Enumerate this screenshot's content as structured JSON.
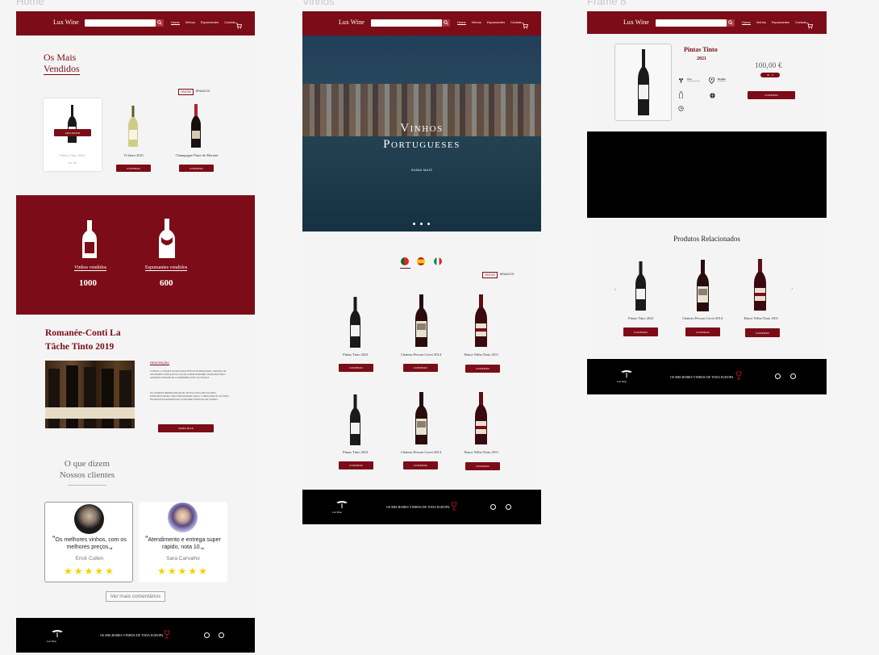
{
  "frames": {
    "home": "Home",
    "vinhos": "Vinhos",
    "frame8": "Frame 8"
  },
  "nav": {
    "logo": "Lux Wine",
    "links": [
      "Home",
      "Vinhos",
      "Espumantes",
      "Contato"
    ],
    "active_link_home": "Home",
    "active_link_vinhos": "Home"
  },
  "home": {
    "best_title_1": "Os Mais",
    "best_title_2": "Vendidos",
    "toggle": [
      "TINTOS",
      "BRANCOS"
    ],
    "products": [
      {
        "name": "Pintas Tinto 2021",
        "price": "R$ 289",
        "overlay": "ADICIONAR",
        "button": ""
      },
      {
        "name": "O Sarro 2021",
        "price": "",
        "button": "COMPRAR"
      },
      {
        "name": "Champagne Pinot de Moroné",
        "price": "",
        "button": "COMPRAR"
      }
    ],
    "stats": [
      {
        "label": "Vinhos vendidos",
        "value": "1000"
      },
      {
        "label": "Espumantes vendidos",
        "value": "600"
      }
    ],
    "feature_title_1": "Romanée-Conti La",
    "feature_title_2": "Tâche Tinto 2019",
    "desc_heading": "DESCRIÇÃO",
    "desc_p1": "O VINHO LA TÂCHE É UM DOS MAIS MÍTICOS DA BORGONHA, ORIUNDO DE UM VINHEDO SINGULAR NA VILA DE VOSNE-ROMANÉE, PRODUZIDO PELO LENDÁRIO DOMAINE DE LA ROMANÉE-CONTI, NA FRANÇA.",
    "desc_p2": "OS VINHEDOS BENEFICIAM-SE DE UM SOLO RICO EM CALCÁRIO, PROPORCIONANDO UMA COMPLEXIDADE ÚNICA. O RESULTADO É UM VINHO DE ELEGÂNCIA EXCEPCIONAL E GRANDE POTENCIAL DE GUARDA.",
    "more_button": "SAIBA MAIS",
    "reviews_title_1": "O que dizem",
    "reviews_title_2": "Nossos clientes",
    "reviews": [
      {
        "quote": "Os melhores vinhos, com os melhores  preços.",
        "name": "Erick Cullen",
        "stars": "★★★★★"
      },
      {
        "quote": "Atendimento e entrega super rapido, nota 10.",
        "name": "Sara Carvalho",
        "stars": "★★★★★"
      }
    ],
    "more_comments": "Ver mais comentários"
  },
  "vinhos": {
    "hero_line1": "Vinhos",
    "hero_line2": "Portugueses",
    "hero_button": "SAIBA MAIS",
    "toggle": [
      "TINTOS",
      "BRANCOS"
    ],
    "products": [
      {
        "name": "Pintas Tinto 2021",
        "button": "COMPRAR"
      },
      {
        "name": "Chateau Pesson Cavet 2014",
        "button": "COMPRAR"
      },
      {
        "name": "Barca Velha Tinto 2011",
        "button": "COMPRAR"
      },
      {
        "name": "Pintas Tinto 2021",
        "button": "COMPRAR"
      },
      {
        "name": "Chateau Pesson Cavet 2014",
        "button": "COMPRAR"
      },
      {
        "name": "Barca Velha Tinto 2011",
        "button": "COMPRAR"
      }
    ]
  },
  "frame8": {
    "product_title": "Pintas Tinto",
    "product_year": "2021",
    "price": "100,00 €",
    "qty": "01",
    "buy": "COMPRAR",
    "spec1_label": "Uva",
    "spec2_label": "Região",
    "related_title": "Produtos Relacionados",
    "related": [
      {
        "name": "Pintas Tinto 2021",
        "button": "COMPRAR"
      },
      {
        "name": "Chateau Pesson Cavet 2014",
        "button": "COMPRAR"
      },
      {
        "name": "Barca Velha Tinto 2011",
        "button": "COMPRAR"
      }
    ]
  },
  "footer": {
    "logo": "Lux Wine",
    "tagline": "OS MELHORES VINHOS DE TODA EUROPA."
  },
  "colors": {
    "wine": "#7c0c17",
    "black": "#000000",
    "star": "#f2d400"
  }
}
